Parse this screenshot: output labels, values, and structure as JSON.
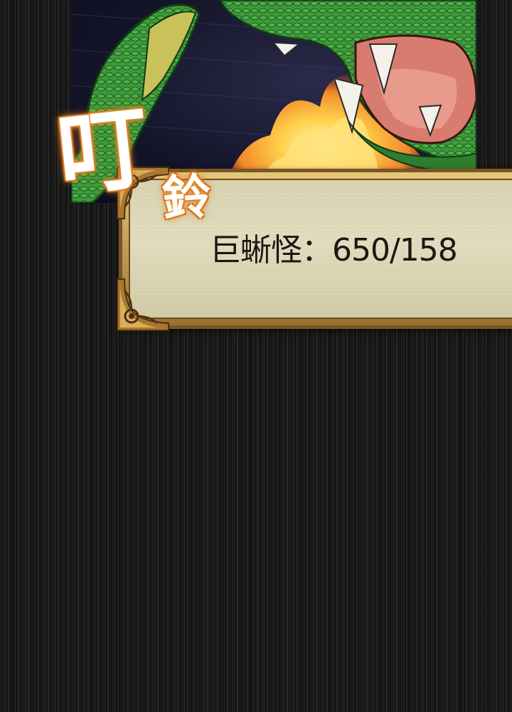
{
  "sfx": {
    "text_large": "叮",
    "text_small": "鈴"
  },
  "notification": {
    "text": "巨蜥怪：650/158"
  },
  "colors": {
    "background": "#141414",
    "panel_parchment": "#ddd7b9",
    "panel_border": "#7b5524",
    "lizard_green": "#3f9a3c",
    "fire": "#f2882a",
    "sfx_glow": "#e07a20"
  },
  "icons": [
    "ornament-corner-icon"
  ]
}
